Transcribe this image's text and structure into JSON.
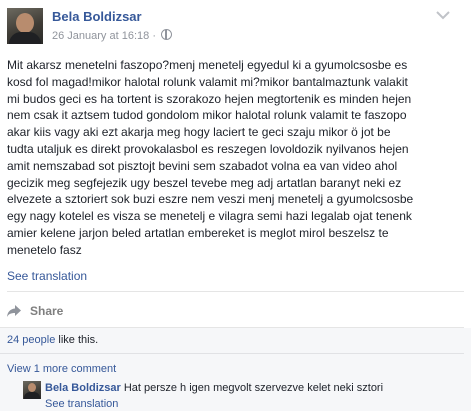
{
  "post": {
    "author": "Bela Boldizsar",
    "timestamp": "26 January at 16:18",
    "separator": "·",
    "text": "Mit akarsz menetelni faszopo?menj menetelj egyedul ki a gyumolcsosbe es\nkosd fol magad!mikor halotal rolunk valamit mi?mikor bantalmaztunk valakit\nmi budos geci es ha tortent is szorakozo hejen megtortenik es minden hejen\nnem csak it aztsem tudod gondolom mikor halotal rolunk valamit te faszopo\nakar kiis vagy aki ezt akarja meg hogy laciert te geci szaju mikor ö jot be\ntudta utaljuk es direkt provokalasbol es reszegen lovoldozik nyilvanos hejen\namit nemszabad sot pisztojt bevini sem szabadot volna ea van video ahol\ngecizik meg segfejezik ugy beszel tevebe meg adj artatlan baranyt neki ez\nelvezete a sztoriert sok buzi eszre nem veszi menj menetelj a gyumolcsosbe\negy nagy kotelel es visza se menetelj e vilagra semi hazi legalab ojat tenenk\namier kelene jarjon beled artatlan embereket is meglot mirol beszelsz te\nmenetelo fasz",
    "see_translation": "See translation",
    "share_label": "Share",
    "likes_count": "24 people",
    "likes_suffix": " like this.",
    "view_more": "View 1 more comment"
  },
  "comment": {
    "author": "Bela Boldizsar",
    "text": "Hat persze h igen megvolt szervezve kelet neki sztori",
    "see_translation": "See translation"
  },
  "icons": {
    "globe": "globe-icon",
    "chevron": "chevron-down-icon",
    "share": "share-arrow-icon"
  },
  "colors": {
    "link": "#365899",
    "text": "#1d2129",
    "meta": "#90949c",
    "footer_bg": "#f6f7f9"
  }
}
